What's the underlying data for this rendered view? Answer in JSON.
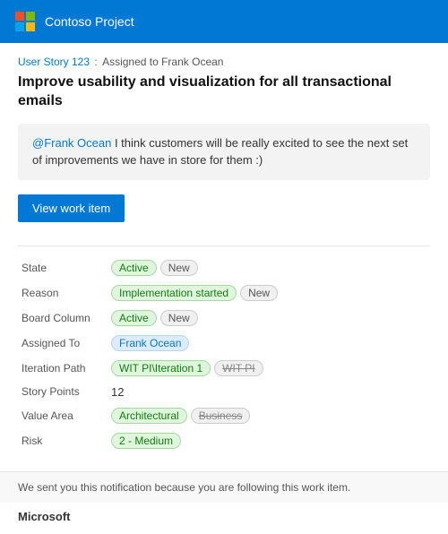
{
  "header": {
    "title": "Contoso Project",
    "logo_label": "Microsoft logo"
  },
  "breadcrumb": {
    "story_label": "User Story 123",
    "separator": ":",
    "assigned_text": "Assigned to Frank Ocean"
  },
  "story": {
    "title": "Improve usability and visualization for all transactional emails"
  },
  "comment": {
    "mention": "@Frank Ocean",
    "text": " I think customers will be really excited to see the next set of improvements we have in store for them :)"
  },
  "button": {
    "view_label": "View work item"
  },
  "fields": [
    {
      "label": "State",
      "tags": [
        {
          "text": "Active",
          "style": "green"
        },
        {
          "text": "New",
          "style": "gray"
        }
      ]
    },
    {
      "label": "Reason",
      "tags": [
        {
          "text": "Implementation started",
          "style": "green"
        },
        {
          "text": "New",
          "style": "gray"
        }
      ]
    },
    {
      "label": "Board Column",
      "tags": [
        {
          "text": "Active",
          "style": "green"
        },
        {
          "text": "New",
          "style": "gray"
        }
      ]
    },
    {
      "label": "Assigned To",
      "tags": [
        {
          "text": "Frank Ocean",
          "style": "blue"
        }
      ]
    },
    {
      "label": "Iteration Path",
      "tags": [
        {
          "text": "WIT PI\\Iteration 1",
          "style": "green"
        },
        {
          "text": "WIT PI",
          "style": "strikethrough"
        }
      ]
    },
    {
      "label": "Story Points",
      "tags": [
        {
          "text": "12",
          "style": "plain"
        }
      ]
    },
    {
      "label": "Value Area",
      "tags": [
        {
          "text": "Architectural",
          "style": "green"
        },
        {
          "text": "Business",
          "style": "strikethrough"
        }
      ]
    },
    {
      "label": "Risk",
      "tags": [
        {
          "text": "2 - Medium",
          "style": "medium"
        }
      ]
    }
  ],
  "footer": {
    "note": "We sent you this notification because you are following this work item.",
    "brand": "Microsoft"
  }
}
